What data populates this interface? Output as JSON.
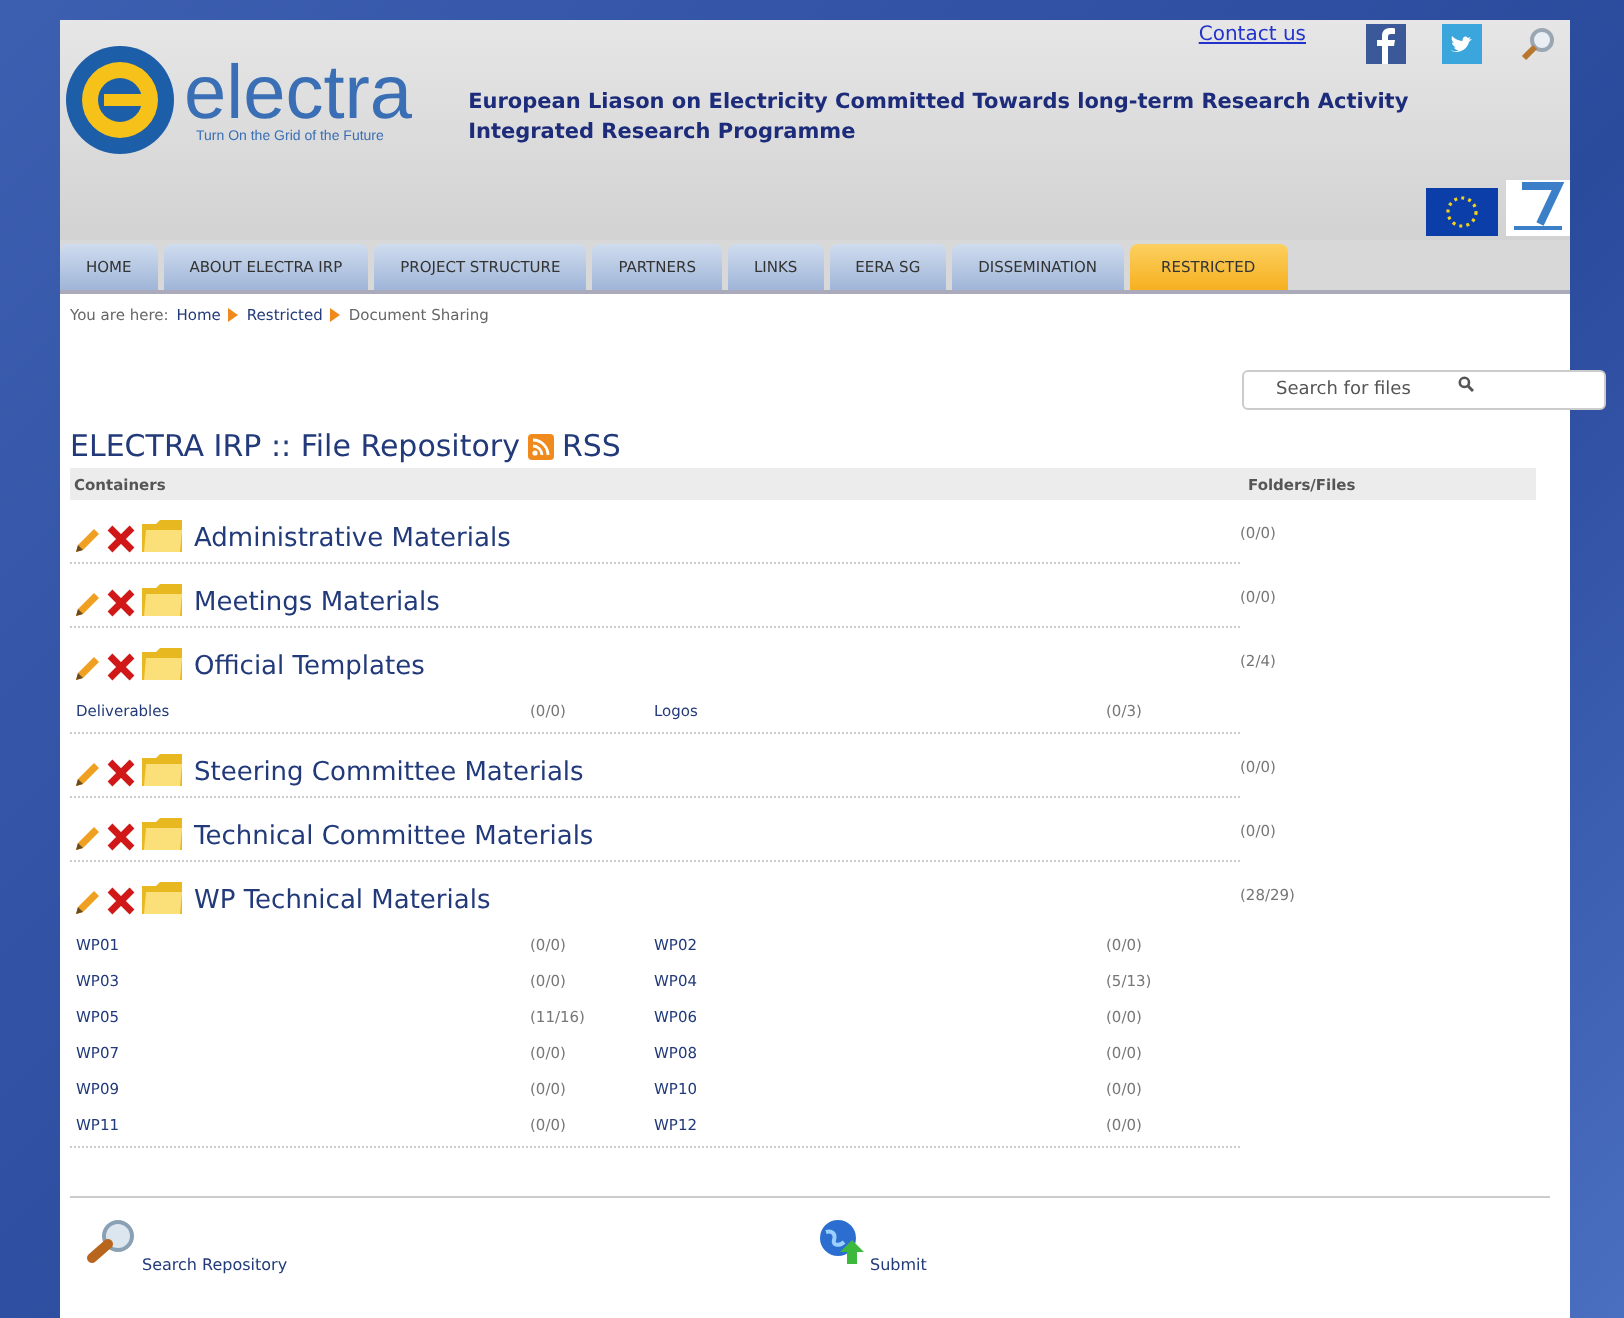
{
  "header": {
    "logo": {
      "name": "electra",
      "tagline": "Turn On the Grid of the Future"
    },
    "project_title": [
      "European Liason on Electricity Committed Towards long-term Research Activity",
      "Integrated Research Programme"
    ],
    "contact_link": "Contact us"
  },
  "nav_tabs": [
    {
      "label": "HOME",
      "selected": false
    },
    {
      "label": "ABOUT ELECTRA IRP",
      "selected": false
    },
    {
      "label": "PROJECT STRUCTURE",
      "selected": false
    },
    {
      "label": "PARTNERS",
      "selected": false
    },
    {
      "label": "LINKS",
      "selected": false
    },
    {
      "label": "EERA SG",
      "selected": false
    },
    {
      "label": "DISSEMINATION",
      "selected": false
    },
    {
      "label": "RESTRICTED",
      "selected": true
    }
  ],
  "breadcrumb": {
    "label": "You are here:",
    "items": [
      {
        "label": "Home",
        "kind": "link"
      },
      {
        "label": "Restricted",
        "kind": "link"
      },
      {
        "label": "Document Sharing",
        "kind": "current"
      }
    ]
  },
  "search": {
    "placeholder": "Search for files"
  },
  "heading": {
    "title": "ELECTRA IRP :: File Repository",
    "rss": "RSS"
  },
  "table": {
    "columns": [
      "Containers",
      "Folders/Files"
    ],
    "rows": [
      {
        "name": "Administrative Materials",
        "count": "(0/0)",
        "children": []
      },
      {
        "name": "Meetings Materials",
        "count": "(0/0)",
        "children": []
      },
      {
        "name": "Official Templates",
        "count": "(2/4)",
        "children": [
          {
            "name": "Deliverables",
            "count": "(0/0)"
          },
          {
            "name": "Logos",
            "count": "(0/3)"
          }
        ]
      },
      {
        "name": "Steering Committee Materials",
        "count": "(0/0)",
        "children": []
      },
      {
        "name": "Technical Committee Materials",
        "count": "(0/0)",
        "children": []
      },
      {
        "name": "WP Technical Materials",
        "count": "(28/29)",
        "children": [
          {
            "name": "WP01",
            "count": "(0/0)"
          },
          {
            "name": "WP02",
            "count": "(0/0)"
          },
          {
            "name": "WP03",
            "count": "(0/0)"
          },
          {
            "name": "WP04",
            "count": "(5/13)"
          },
          {
            "name": "WP05",
            "count": "(11/16)"
          },
          {
            "name": "WP06",
            "count": "(0/0)"
          },
          {
            "name": "WP07",
            "count": "(0/0)"
          },
          {
            "name": "WP08",
            "count": "(0/0)"
          },
          {
            "name": "WP09",
            "count": "(0/0)"
          },
          {
            "name": "WP10",
            "count": "(0/0)"
          },
          {
            "name": "WP11",
            "count": "(0/0)"
          },
          {
            "name": "WP12",
            "count": "(0/0)"
          }
        ]
      }
    ]
  },
  "footer_actions": [
    {
      "label": "Search Repository",
      "kind": "search"
    },
    {
      "label": "Submit",
      "kind": "submit"
    }
  ]
}
